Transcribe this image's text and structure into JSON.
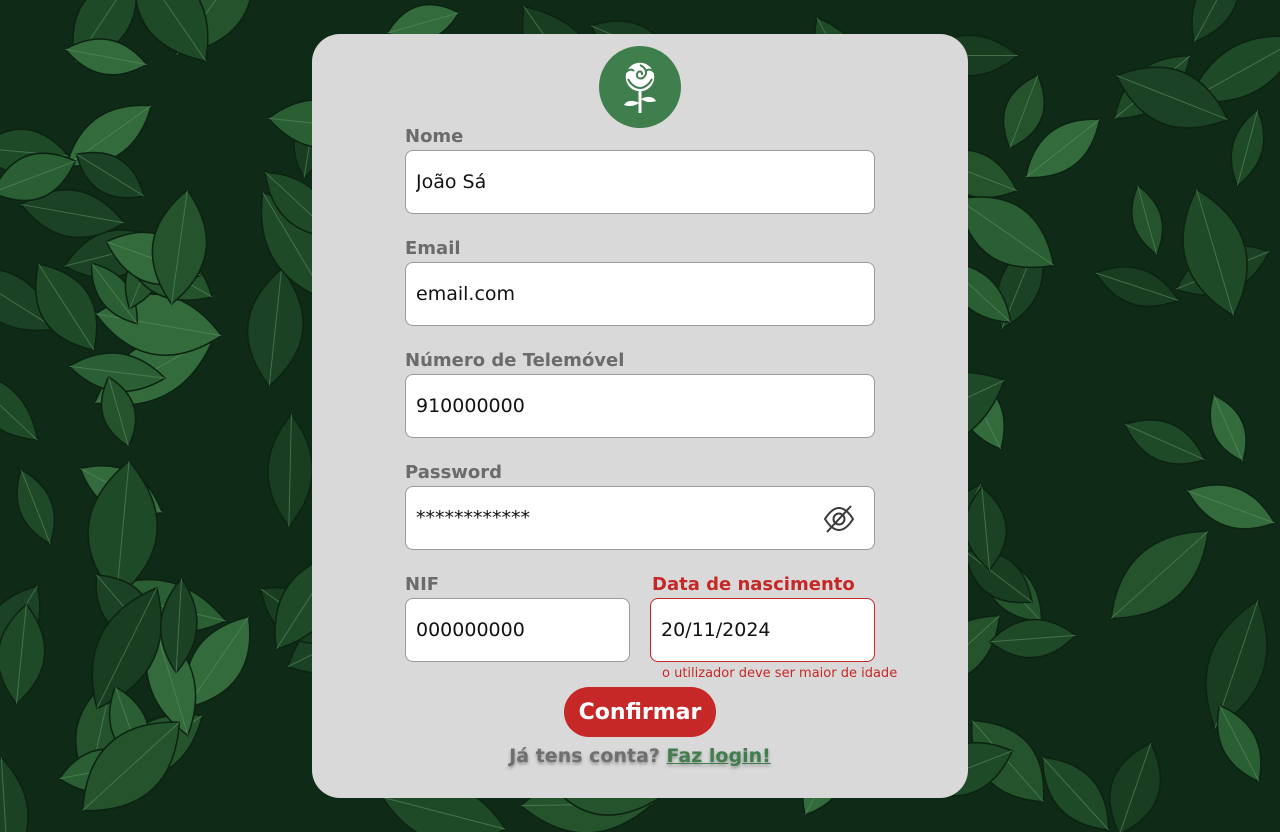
{
  "logo": {
    "icon": "rose-icon",
    "color": "#3f7f4e"
  },
  "form": {
    "name": {
      "label": "Nome",
      "value": "João Sá"
    },
    "email": {
      "label": "Email",
      "value": "email.com"
    },
    "phone": {
      "label": "Número de Telemóvel",
      "value": "910000000"
    },
    "password": {
      "label": "Password",
      "value": "************",
      "toggle_icon": "eye-slash-icon"
    },
    "nif": {
      "label": "NIF",
      "value": "000000000"
    },
    "birthdate": {
      "label": "Data de nascimento",
      "value": "20/11/2024",
      "error": "o utilizador deve ser maior de idade"
    }
  },
  "submit": {
    "label": "Confirmar"
  },
  "footer": {
    "question": "Já tens conta?",
    "link": "Faz login!"
  },
  "colors": {
    "accent": "#3f7f4e",
    "error": "#c62828",
    "card": "#d9d9d9",
    "background": "#0f2a17"
  }
}
